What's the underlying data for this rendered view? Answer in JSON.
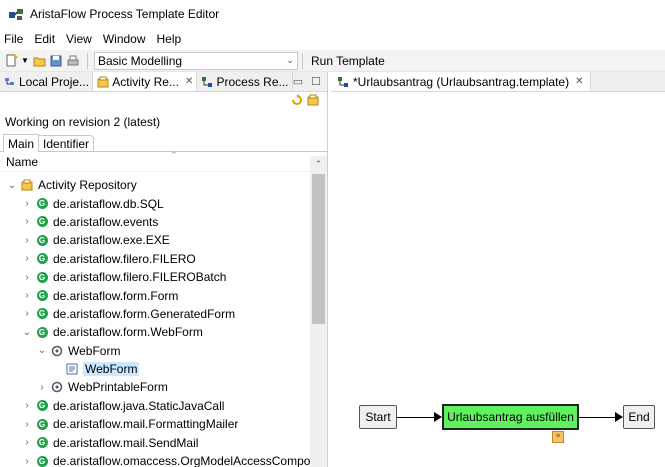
{
  "window": {
    "title": "AristaFlow Process Template Editor"
  },
  "menu": [
    "File",
    "Edit",
    "View",
    "Window",
    "Help"
  ],
  "toolbar": {
    "perspective_value": "Basic Modelling",
    "run_label": "Run Template"
  },
  "left_tabs": [
    {
      "label": "Local Proje..."
    },
    {
      "label": "Activity Re..."
    },
    {
      "label": "Process Re..."
    }
  ],
  "repository": {
    "revision_text": "Working on revision 2 (latest)",
    "subtabs": [
      "Main",
      "Identifier"
    ],
    "column_header": "Name",
    "tree": [
      {
        "label": "Activity Repository",
        "twisty": "⌄",
        "icon": "repository-icon",
        "selected": false
      },
      {
        "label": "de.aristaflow.db.SQL",
        "twisty": "›",
        "icon": "package-icon",
        "selected": false
      },
      {
        "label": "de.aristaflow.events",
        "twisty": "›",
        "icon": "package-icon",
        "selected": false
      },
      {
        "label": "de.aristaflow.exe.EXE",
        "twisty": "›",
        "icon": "package-icon",
        "selected": false
      },
      {
        "label": "de.aristaflow.filero.FILERO",
        "twisty": "›",
        "icon": "package-icon",
        "selected": false
      },
      {
        "label": "de.aristaflow.filero.FILEROBatch",
        "twisty": "›",
        "icon": "package-icon",
        "selected": false
      },
      {
        "label": "de.aristaflow.form.Form",
        "twisty": "›",
        "icon": "package-icon",
        "selected": false
      },
      {
        "label": "de.aristaflow.form.GeneratedForm",
        "twisty": "›",
        "icon": "package-icon",
        "selected": false
      },
      {
        "label": "de.aristaflow.form.WebForm",
        "twisty": "⌄",
        "icon": "package-icon",
        "selected": false
      },
      {
        "label": "WebForm",
        "twisty": "⌄",
        "icon": "component-icon",
        "selected": false
      },
      {
        "label": "WebForm",
        "twisty": "",
        "icon": "form-icon",
        "selected": true
      },
      {
        "label": "WebPrintableForm",
        "twisty": "›",
        "icon": "component-icon",
        "selected": false
      },
      {
        "label": "de.aristaflow.java.StaticJavaCall",
        "twisty": "›",
        "icon": "package-icon",
        "selected": false
      },
      {
        "label": "de.aristaflow.mail.FormattingMailer",
        "twisty": "›",
        "icon": "package-icon",
        "selected": false
      },
      {
        "label": "de.aristaflow.mail.SendMail",
        "twisty": "›",
        "icon": "package-icon",
        "selected": false
      },
      {
        "label": "de.aristaflow.omaccess.OrgModelAccessComponent",
        "twisty": "›",
        "icon": "package-icon",
        "selected": false
      }
    ]
  },
  "editor": {
    "tab_label": "*Urlaubsantrag (Urlaubsantrag.template)",
    "nodes": {
      "start": "Start",
      "activity": "Urlaubsantrag ausfüllen",
      "end": "End"
    }
  },
  "colors": {
    "activity_fill": "#5ef25e",
    "selection": "#cce8ff",
    "package_icon": "#21a04a"
  }
}
